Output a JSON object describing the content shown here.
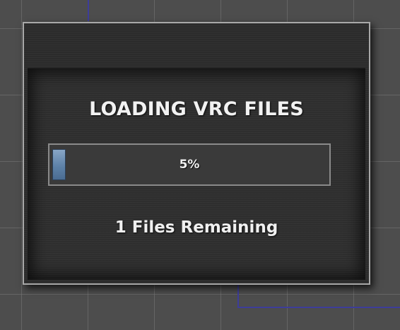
{
  "dialog": {
    "title": "LOADING VRC FILES",
    "progress": {
      "percent": 5,
      "label": "5%"
    },
    "status": "1 Files Remaining"
  },
  "colors": {
    "background": "#4d4d4d",
    "dialog": "#2b2b2b",
    "dialog_border": "#a8a8a8",
    "progress_fill": "#5e82a8",
    "text": "#f2f2f2",
    "connector_line": "#3d3d9a"
  }
}
